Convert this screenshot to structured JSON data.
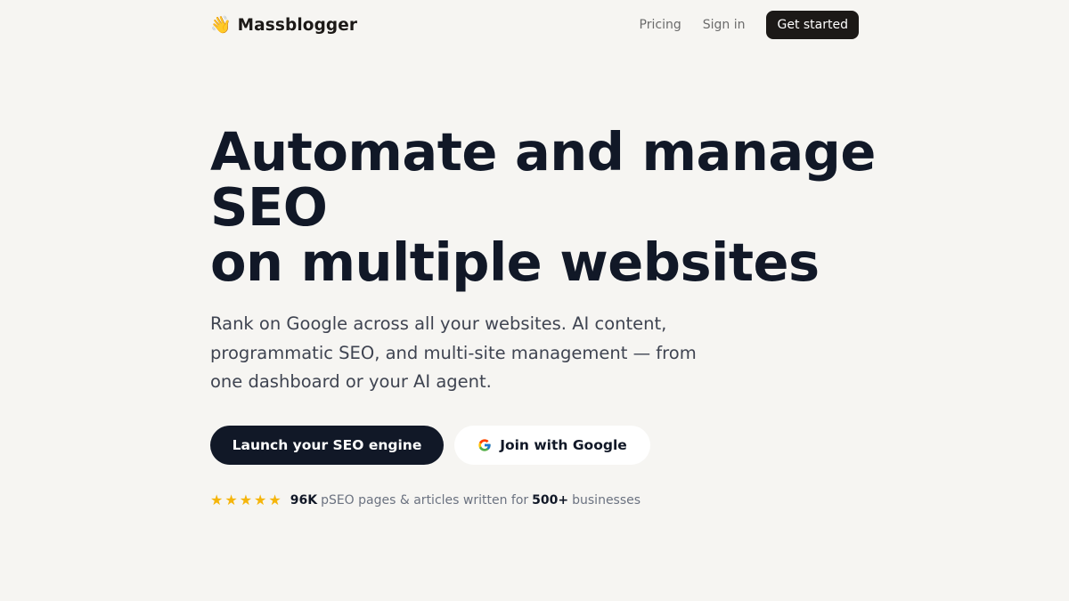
{
  "nav": {
    "brand_emoji": "👋",
    "brand_name": "Massblogger",
    "pricing": "Pricing",
    "sign_in": "Sign in",
    "get_started": "Get started"
  },
  "hero": {
    "title_line1": "Automate and manage",
    "title_line2": "SEO",
    "title_line3": "on multiple websites",
    "subtitle": "Rank on Google across all your websites. AI content, programmatic SEO, and multi-site management — from one dashboard or your AI agent."
  },
  "cta": {
    "primary": "Launch your SEO engine",
    "google": "Join with Google"
  },
  "social_proof": {
    "rating_stars": 5,
    "pages_count": "96K",
    "pages_text": "pSEO pages & articles written for",
    "business_count": "500+",
    "business_text": "businesses"
  },
  "colors": {
    "background": "#f6f5f2",
    "primary_dark": "#111827",
    "star": "#f5b50a"
  }
}
